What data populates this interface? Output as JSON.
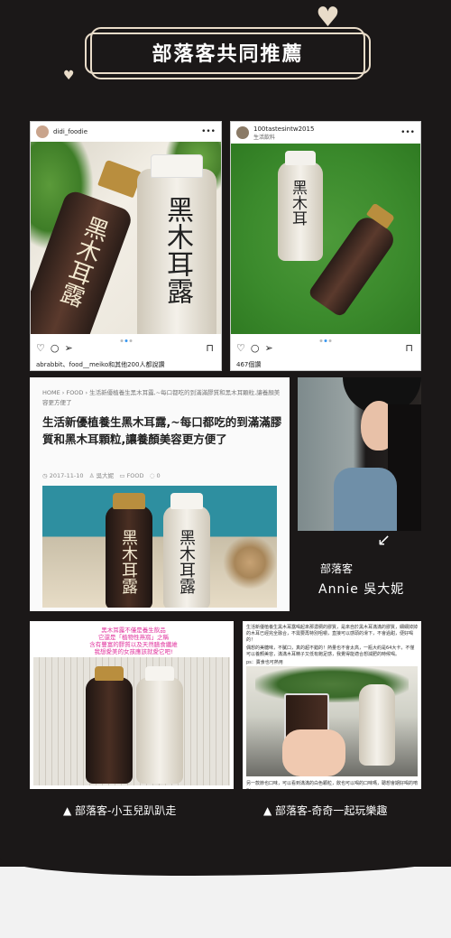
{
  "header": {
    "title": "部落客共同推薦"
  },
  "instagram": [
    {
      "username": "didi_foodie",
      "subtitle": "",
      "caption": "abrabbit、food__meiko和其他200人都說讚"
    },
    {
      "username": "100tastesintw2015",
      "subtitle": "生活飲料",
      "caption": "467個讚"
    }
  ],
  "blog": {
    "breadcrumb": "HOME  ›  FOOD  ›  生活新優植養生黑木耳露,~每口都吃的到滿滿膠質和黑木耳顆粒,讓養顏美容更方便了",
    "title": "生活新優植養生黑木耳露,~每口都吃的到滿滿膠質和黑木耳顆粒,讓養顏美容更方便了",
    "date": "2017-11-10",
    "author": "吳大妮",
    "category": "FOOD",
    "comments": "0"
  },
  "annie": {
    "label": "部落客",
    "name": "Annie  吳大妮"
  },
  "card3": {
    "pink_text": "黑木耳露不僅是養生飲品\n它還是「植物性燕窩」之稱\n含有豐富的膠質以及天然膳食纖維\n我想愛美的女孩應該就愛它吧!"
  },
  "card4": {
    "text": "生活新優植養生黑木耳露喝起來那濃稠的膠質，是來自於黑木耳滿滿的膠質，細細掉掉的木耳已經完全融合，不需要再特別咀嚼，直接可以感頭的滑下，不會過甜，便好喝的！",
    "text2": "偶想的美糖味，不膩口，真的超不錯的！熱量也不會太高，一瓶大約是64大卡，不僅可以養顏美容，滿滿木耳精子又低有飽足感，我覺得能適合想減肥的時候喝。",
    "text3": "ps：賣食也可熱用",
    "foot": "另一款節也口味，可以看到滿滿的白色顆粒，飲也可以喝的口味嗎，聰想會期好喝的唷～"
  },
  "captions": {
    "left": "▲  部落客-小玉兒趴趴走",
    "right": "▲  部落客-奇奇一起玩樂趣"
  }
}
